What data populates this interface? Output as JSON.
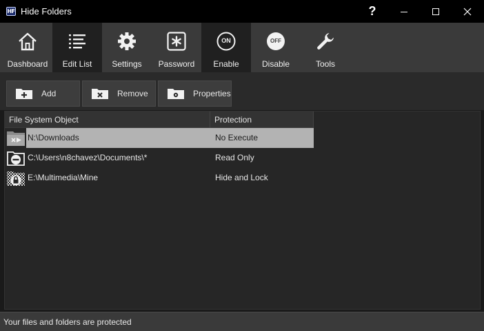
{
  "window": {
    "title": "Hide Folders",
    "icon_text": "HF",
    "help_label": "?"
  },
  "toolbar": {
    "items": [
      {
        "label": "Dashboard",
        "icon": "home-icon",
        "active": false
      },
      {
        "label": "Edit List",
        "icon": "list-icon",
        "active": true
      },
      {
        "label": "Settings",
        "icon": "gear-icon",
        "active": false
      },
      {
        "label": "Password",
        "icon": "asterisk-box-icon",
        "active": false
      },
      {
        "label": "Enable",
        "icon": "on-icon",
        "active": true
      },
      {
        "label": "Disable",
        "icon": "off-icon",
        "active": false
      },
      {
        "label": "Tools",
        "icon": "wrench-icon",
        "active": false
      }
    ],
    "on_text": "ON",
    "off_text": "OFF"
  },
  "actions": {
    "add_label": "Add",
    "remove_label": "Remove",
    "properties_label": "Properties"
  },
  "list": {
    "columns": [
      "File System Object",
      "Protection"
    ],
    "rows": [
      {
        "path": "N:\\Downloads",
        "protection": "No Execute",
        "icon": "no-execute-folder-icon",
        "selected": true
      },
      {
        "path": "C:\\Users\\n8chavez\\Documents\\*",
        "protection": "Read Only",
        "icon": "read-only-folder-icon",
        "selected": false
      },
      {
        "path": "E:\\Multimedia\\Mine",
        "protection": "Hide and Lock",
        "icon": "hidden-locked-folder-icon",
        "selected": false
      }
    ]
  },
  "status": {
    "text": "Your files and folders are protected"
  },
  "colors": {
    "titlebar": "#000000",
    "toolbar": "#3a3a3a",
    "toolbar_active": "#202020",
    "selection": "#b3b3b3"
  }
}
